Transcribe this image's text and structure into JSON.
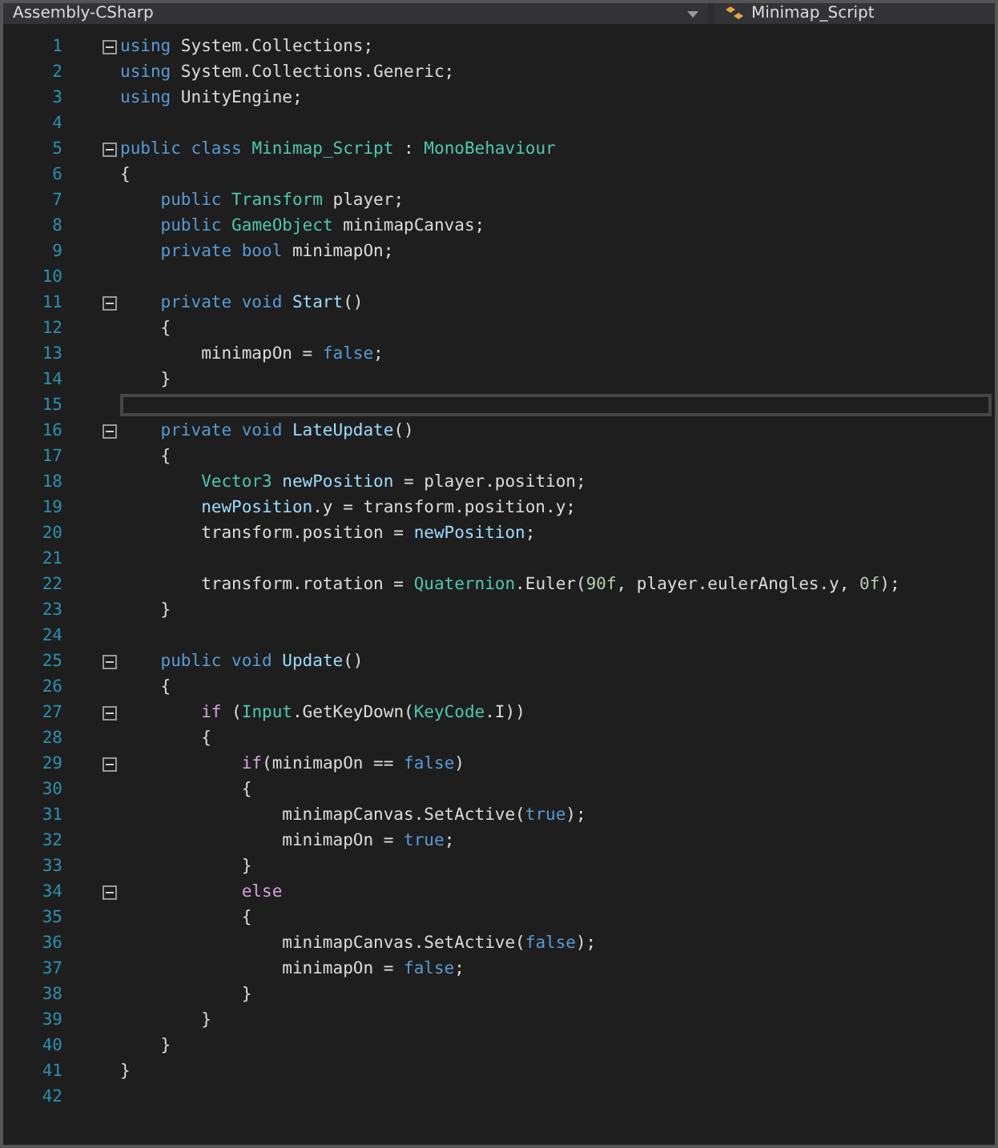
{
  "navigation_bar": {
    "project": "Assembly-CSharp",
    "class": "Minimap_Script"
  },
  "lines": [
    {
      "number": "1",
      "fold": true,
      "current": false,
      "tokens": [
        {
          "text": "using",
          "kind": "kw"
        },
        {
          "text": " System.Collections;",
          "kind": "plain"
        }
      ]
    },
    {
      "number": "2",
      "fold": false,
      "current": false,
      "tokens": [
        {
          "text": "using",
          "kind": "kw"
        },
        {
          "text": " System.Collections.Generic;",
          "kind": "plain"
        }
      ]
    },
    {
      "number": "3",
      "fold": false,
      "current": false,
      "tokens": [
        {
          "text": "using",
          "kind": "kw"
        },
        {
          "text": " UnityEngine;",
          "kind": "plain"
        }
      ]
    },
    {
      "number": "4",
      "fold": false,
      "current": false
    },
    {
      "number": "5",
      "fold": true,
      "current": false,
      "tokens": [
        {
          "text": "public class ",
          "kind": "kw"
        },
        {
          "text": "Minimap_Script",
          "kind": "type"
        },
        {
          "text": " : ",
          "kind": "plain"
        },
        {
          "text": "MonoBehaviour",
          "kind": "type"
        }
      ]
    },
    {
      "number": "6",
      "fold": false,
      "current": false,
      "tokens": [
        {
          "text": "{",
          "kind": "plain"
        }
      ]
    },
    {
      "number": "7",
      "fold": false,
      "current": false,
      "tokens": [
        {
          "text": "    public ",
          "kind": "kw"
        },
        {
          "text": "Transform",
          "kind": "type"
        },
        {
          "text": " player;",
          "kind": "plain"
        }
      ]
    },
    {
      "number": "8",
      "fold": false,
      "current": false,
      "tokens": [
        {
          "text": "    public ",
          "kind": "kw"
        },
        {
          "text": "GameObject",
          "kind": "type"
        },
        {
          "text": " minimapCanvas;",
          "kind": "plain"
        }
      ]
    },
    {
      "number": "9",
      "fold": false,
      "current": false,
      "tokens": [
        {
          "text": "    private bool",
          "kind": "kw"
        },
        {
          "text": " minimapOn;",
          "kind": "plain"
        }
      ]
    },
    {
      "number": "10",
      "fold": false,
      "current": false
    },
    {
      "number": "11",
      "fold": true,
      "current": false,
      "tokens": [
        {
          "text": "    private void ",
          "kind": "kw"
        },
        {
          "text": "Start",
          "kind": "name"
        },
        {
          "text": "()",
          "kind": "plain"
        }
      ]
    },
    {
      "number": "12",
      "fold": false,
      "current": false,
      "tokens": [
        {
          "text": "    {",
          "kind": "plain"
        }
      ]
    },
    {
      "number": "13",
      "fold": false,
      "current": false,
      "tokens": [
        {
          "text": "        minimapOn = ",
          "kind": "plain"
        },
        {
          "text": "false",
          "kind": "kw"
        },
        {
          "text": ";",
          "kind": "plain"
        }
      ]
    },
    {
      "number": "14",
      "fold": false,
      "current": false,
      "tokens": [
        {
          "text": "    }",
          "kind": "plain"
        }
      ]
    },
    {
      "number": "15",
      "fold": false,
      "current": true
    },
    {
      "number": "16",
      "fold": true,
      "current": false,
      "tokens": [
        {
          "text": "    private void ",
          "kind": "kw"
        },
        {
          "text": "LateUpdate",
          "kind": "name"
        },
        {
          "text": "()",
          "kind": "plain"
        }
      ]
    },
    {
      "number": "17",
      "fold": false,
      "current": false,
      "tokens": [
        {
          "text": "    {",
          "kind": "plain"
        }
      ]
    },
    {
      "number": "18",
      "fold": false,
      "current": false,
      "tokens": [
        {
          "text": "        Vector3",
          "kind": "type"
        },
        {
          "text": " newPosition",
          "kind": "name"
        },
        {
          "text": " = player.position;",
          "kind": "plain"
        }
      ]
    },
    {
      "number": "19",
      "fold": false,
      "current": false,
      "tokens": [
        {
          "text": "        newPosition",
          "kind": "name"
        },
        {
          "text": ".y = transform.position.y;",
          "kind": "plain"
        }
      ]
    },
    {
      "number": "20",
      "fold": false,
      "current": false,
      "tokens": [
        {
          "text": "        transform.position = ",
          "kind": "plain"
        },
        {
          "text": "newPosition",
          "kind": "name"
        },
        {
          "text": ";",
          "kind": "plain"
        }
      ]
    },
    {
      "number": "21",
      "fold": false,
      "current": false
    },
    {
      "number": "22",
      "fold": false,
      "current": false,
      "tokens": [
        {
          "text": "        transform.rotation = ",
          "kind": "plain"
        },
        {
          "text": "Quaternion",
          "kind": "type"
        },
        {
          "text": ".Euler(",
          "kind": "plain"
        },
        {
          "text": "90f",
          "kind": "num"
        },
        {
          "text": ", player.eulerAngles.y, ",
          "kind": "plain"
        },
        {
          "text": "0f",
          "kind": "num"
        },
        {
          "text": ");",
          "kind": "plain"
        }
      ]
    },
    {
      "number": "23",
      "fold": false,
      "current": false,
      "tokens": [
        {
          "text": "    }",
          "kind": "plain"
        }
      ]
    },
    {
      "number": "24",
      "fold": false,
      "current": false
    },
    {
      "number": "25",
      "fold": true,
      "current": false,
      "tokens": [
        {
          "text": "    public void ",
          "kind": "kw"
        },
        {
          "text": "Update",
          "kind": "name"
        },
        {
          "text": "()",
          "kind": "plain"
        }
      ]
    },
    {
      "number": "26",
      "fold": false,
      "current": false,
      "tokens": [
        {
          "text": "    {",
          "kind": "plain"
        }
      ]
    },
    {
      "number": "27",
      "fold": true,
      "current": false,
      "tokens": [
        {
          "text": "        if",
          "kind": "ctrl"
        },
        {
          "text": " (",
          "kind": "plain"
        },
        {
          "text": "Input",
          "kind": "type"
        },
        {
          "text": ".GetKeyDown(",
          "kind": "plain"
        },
        {
          "text": "KeyCode",
          "kind": "type"
        },
        {
          "text": ".I))",
          "kind": "plain"
        }
      ]
    },
    {
      "number": "28",
      "fold": false,
      "current": false,
      "tokens": [
        {
          "text": "        {",
          "kind": "plain"
        }
      ]
    },
    {
      "number": "29",
      "fold": true,
      "current": false,
      "tokens": [
        {
          "text": "            if",
          "kind": "ctrl"
        },
        {
          "text": "(minimapOn == ",
          "kind": "plain"
        },
        {
          "text": "false",
          "kind": "kw"
        },
        {
          "text": ")",
          "kind": "plain"
        }
      ]
    },
    {
      "number": "30",
      "fold": false,
      "current": false,
      "tokens": [
        {
          "text": "            {",
          "kind": "plain"
        }
      ]
    },
    {
      "number": "31",
      "fold": false,
      "current": false,
      "tokens": [
        {
          "text": "                minimapCanvas.SetActive(",
          "kind": "plain"
        },
        {
          "text": "true",
          "kind": "kw"
        },
        {
          "text": ");",
          "kind": "plain"
        }
      ]
    },
    {
      "number": "32",
      "fold": false,
      "current": false,
      "tokens": [
        {
          "text": "                minimapOn = ",
          "kind": "plain"
        },
        {
          "text": "true",
          "kind": "kw"
        },
        {
          "text": ";",
          "kind": "plain"
        }
      ]
    },
    {
      "number": "33",
      "fold": false,
      "current": false,
      "tokens": [
        {
          "text": "            }",
          "kind": "plain"
        }
      ]
    },
    {
      "number": "34",
      "fold": true,
      "current": false,
      "tokens": [
        {
          "text": "            else",
          "kind": "ctrl"
        }
      ]
    },
    {
      "number": "35",
      "fold": false,
      "current": false,
      "tokens": [
        {
          "text": "            {",
          "kind": "plain"
        }
      ]
    },
    {
      "number": "36",
      "fold": false,
      "current": false,
      "tokens": [
        {
          "text": "                minimapCanvas.SetActive(",
          "kind": "plain"
        },
        {
          "text": "false",
          "kind": "kw"
        },
        {
          "text": ");",
          "kind": "plain"
        }
      ]
    },
    {
      "number": "37",
      "fold": false,
      "current": false,
      "tokens": [
        {
          "text": "                minimapOn = ",
          "kind": "plain"
        },
        {
          "text": "false",
          "kind": "kw"
        },
        {
          "text": ";",
          "kind": "plain"
        }
      ]
    },
    {
      "number": "38",
      "fold": false,
      "current": false,
      "tokens": [
        {
          "text": "            }",
          "kind": "plain"
        }
      ]
    },
    {
      "number": "39",
      "fold": false,
      "current": false,
      "tokens": [
        {
          "text": "        }",
          "kind": "plain"
        }
      ]
    },
    {
      "number": "40",
      "fold": false,
      "current": false,
      "tokens": [
        {
          "text": "    }",
          "kind": "plain"
        }
      ]
    },
    {
      "number": "41",
      "fold": false,
      "current": false,
      "tokens": [
        {
          "text": "}",
          "kind": "plain"
        }
      ]
    },
    {
      "number": "42",
      "fold": false,
      "current": false
    }
  ]
}
